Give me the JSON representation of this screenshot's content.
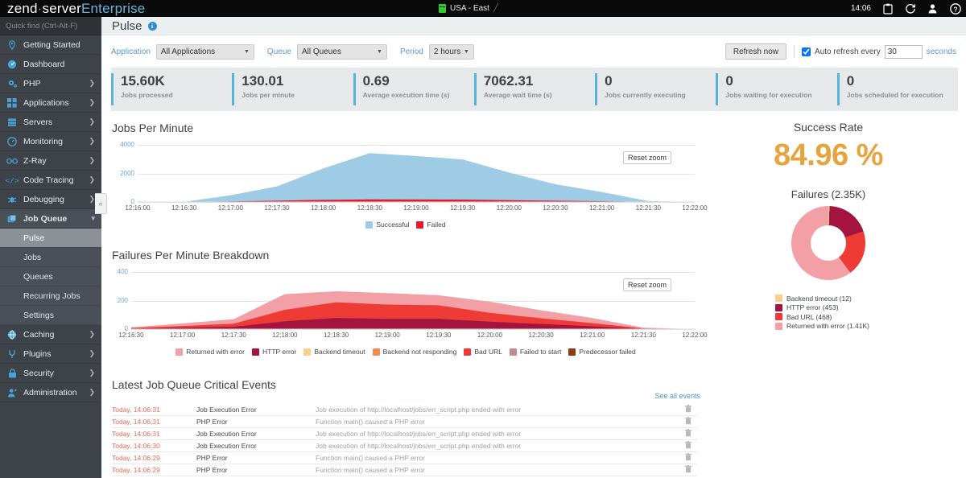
{
  "topbar": {
    "brand_part1": "zend",
    "brand_dot": "·",
    "brand_part2": "server",
    "brand_part3": "Enterprise",
    "server_label": "USA - East",
    "edit_glyph": "╱",
    "time": "14:06",
    "icons": [
      "clipboard-icon",
      "refresh-icon",
      "user-icon",
      "help-icon"
    ]
  },
  "sidebar": {
    "quickfind_placeholder": "Quick find (Ctrl-Alt-F)",
    "items": [
      {
        "label": "Getting Started",
        "icon": "location-pin-icon",
        "expandable": false
      },
      {
        "label": "Dashboard",
        "icon": "gauge-icon",
        "expandable": false
      },
      {
        "label": "PHP",
        "icon": "gears-icon",
        "expandable": true
      },
      {
        "label": "Applications",
        "icon": "grid-icon",
        "expandable": true
      },
      {
        "label": "Servers",
        "icon": "server-stack-icon",
        "expandable": true
      },
      {
        "label": "Monitoring",
        "icon": "speedometer-icon",
        "expandable": true
      },
      {
        "label": "Z-Ray",
        "icon": "glasses-icon",
        "expandable": true
      },
      {
        "label": "Code Tracing",
        "icon": "code-brackets-icon",
        "expandable": true
      },
      {
        "label": "Debugging",
        "icon": "bug-icon",
        "expandable": true
      },
      {
        "label": "Job Queue",
        "icon": "layers-icon",
        "expandable": true,
        "open": true
      }
    ],
    "subitems": [
      "Pulse",
      "Jobs",
      "Queues",
      "Recurring Jobs",
      "Settings"
    ],
    "active_subitem": "Pulse",
    "items_after": [
      {
        "label": "Caching",
        "icon": "globe-icon",
        "expandable": true
      },
      {
        "label": "Plugins",
        "icon": "plug-icon",
        "expandable": true
      },
      {
        "label": "Security",
        "icon": "lock-icon",
        "expandable": true
      },
      {
        "label": "Administration",
        "icon": "user-admin-icon",
        "expandable": true
      }
    ],
    "collapse_glyph": "«"
  },
  "page": {
    "title": "Pulse",
    "info_glyph": "i"
  },
  "filters": {
    "application_label": "Application",
    "application_value": "All Applications",
    "queue_label": "Queue",
    "queue_value": "All Queues",
    "period_label": "Period",
    "period_value": "2 hours",
    "refresh_now": "Refresh now",
    "auto_refresh_label": "Auto refresh every",
    "auto_refresh_checked": true,
    "auto_refresh_seconds": "30",
    "seconds_label": "seconds"
  },
  "kpis": [
    {
      "value": "15.60K",
      "label": "Jobs processed"
    },
    {
      "value": "130.01",
      "label": "Jobs per minute"
    },
    {
      "value": "0.69",
      "label": "Average execution time (s)"
    },
    {
      "value": "7062.31",
      "label": "Average wait time (s)"
    },
    {
      "value": "0",
      "label": "Jobs currently executing"
    },
    {
      "value": "0",
      "label": "Jobs waiting for execution"
    },
    {
      "value": "0",
      "label": "Jobs scheduled for execution"
    }
  ],
  "chart_data": [
    {
      "type": "area",
      "name": "jobs-per-minute",
      "title": "Jobs Per Minute",
      "reset_zoom_label": "Reset zoom",
      "x": [
        "12:16:00",
        "12:16:30",
        "12:17:00",
        "12:17:30",
        "12:18:00",
        "12:18:30",
        "12:19:00",
        "12:19:30",
        "12:20:00",
        "12:20:30",
        "12:21:00",
        "12:21:30",
        "12:22:00"
      ],
      "xlabel": "",
      "ylabel": "",
      "ylim": [
        0,
        4000
      ],
      "yticks": [
        0,
        2000,
        4000
      ],
      "grid": true,
      "legend_position": "bottom",
      "series": [
        {
          "name": "Successful",
          "color": "#9ecce4",
          "values": [
            0,
            10,
            470,
            1090,
            2350,
            3420,
            3220,
            2980,
            2060,
            1240,
            700,
            60,
            0
          ]
        },
        {
          "name": "Failed",
          "color": "#e8192c",
          "values": [
            0,
            5,
            40,
            95,
            150,
            185,
            175,
            170,
            130,
            90,
            55,
            10,
            0
          ]
        }
      ]
    },
    {
      "type": "area",
      "name": "failures-per-minute-breakdown",
      "title": "Failures Per Minute Breakdown",
      "reset_zoom_label": "Reset zoom",
      "x": [
        "12:16:30",
        "12:17:00",
        "12:17:30",
        "12:18:00",
        "12:18:30",
        "12:19:00",
        "12:19:30",
        "12:20:00",
        "12:20:30",
        "12:21:00",
        "12:21:30",
        "12:22:00"
      ],
      "xlabel": "",
      "ylabel": "",
      "ylim": [
        0,
        400
      ],
      "yticks": [
        0,
        200,
        400
      ],
      "grid": true,
      "legend_position": "bottom",
      "stacked": true,
      "series": [
        {
          "name": "Returned with error",
          "color": "#f2a0a6",
          "values": [
            5,
            18,
            32,
            110,
            77,
            80,
            70,
            78,
            56,
            36,
            5,
            0
          ]
        },
        {
          "name": "HTTP error",
          "color": "#a31540",
          "values": [
            3,
            10,
            16,
            55,
            78,
            72,
            72,
            52,
            36,
            20,
            2,
            0
          ]
        },
        {
          "name": "Backend timeout",
          "color": "#fbd08a",
          "values": [
            0,
            0,
            0,
            0,
            0,
            0,
            0,
            0,
            0,
            0,
            0,
            0
          ]
        },
        {
          "name": "Backend not responding",
          "color": "#f58b50",
          "values": [
            0,
            0,
            0,
            0,
            0,
            0,
            0,
            0,
            0,
            0,
            0,
            0
          ]
        },
        {
          "name": "Bad URL",
          "color": "#ef3b36",
          "values": [
            5,
            12,
            22,
            80,
            110,
            100,
            95,
            62,
            40,
            22,
            3,
            0
          ]
        },
        {
          "name": "Failed to start",
          "color": "#c48b8b",
          "values": [
            0,
            0,
            0,
            0,
            0,
            0,
            0,
            0,
            0,
            0,
            0,
            0
          ]
        },
        {
          "name": "Predecessor failed",
          "color": "#8a3d11",
          "values": [
            0,
            0,
            0,
            0,
            0,
            0,
            0,
            0,
            0,
            0,
            0,
            0
          ]
        }
      ]
    },
    {
      "type": "pie",
      "name": "failures-donut",
      "title": "Failures (2.35K)",
      "success_rate_title": "Success Rate",
      "success_rate_value": "84.96 %",
      "success_rate_color": "#e7a33c",
      "labels": [
        "Backend timeout (12)",
        "HTTP error (453)",
        "Bad URL (468)",
        "Returned with error (1.41K)"
      ],
      "values": [
        12,
        453,
        468,
        1410
      ],
      "colors": [
        "#fbd08a",
        "#a31540",
        "#ef3b36",
        "#f2a0a6"
      ],
      "legend_position": "bottom"
    }
  ],
  "events": {
    "title": "Latest Job Queue Critical Events",
    "see_all_label": "See all events",
    "rows": [
      {
        "time": "Today, 14:06:31",
        "type": "Job Execution Error",
        "message": "Job execution of http://localhost/jobs/err_script.php ended with error"
      },
      {
        "time": "Today, 14:06:31",
        "type": "PHP Error",
        "message": "Function main() caused a PHP error"
      },
      {
        "time": "Today, 14:06:31",
        "type": "Job Execution Error",
        "message": "Job execution of http://localhost/jobs/err_script.php ended with error"
      },
      {
        "time": "Today, 14:06:30",
        "type": "Job Execution Error",
        "message": "Job execution of http://localhost/jobs/err_script.php ended with error"
      },
      {
        "time": "Today, 14:06:29",
        "type": "PHP Error",
        "message": "Function main() caused a PHP error"
      },
      {
        "time": "Today, 14:06:29",
        "type": "PHP Error",
        "message": "Function main() caused a PHP error"
      }
    ],
    "delete_icon": "trash-icon"
  }
}
